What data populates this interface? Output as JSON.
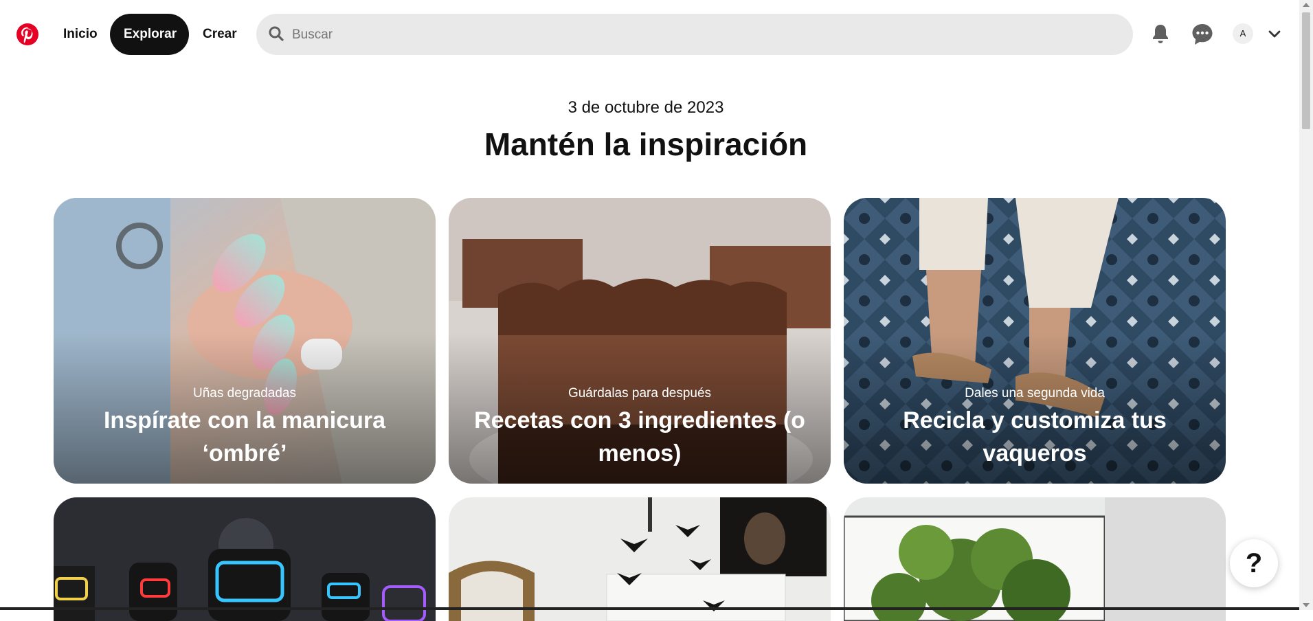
{
  "header": {
    "nav": {
      "home_label": "Inicio",
      "explore_label": "Explorar",
      "create_label": "Crear"
    },
    "search": {
      "placeholder": "Buscar",
      "value": ""
    },
    "avatar_initial": "A",
    "icons": [
      "pinterest-logo",
      "search-icon",
      "bell-icon",
      "chat-icon",
      "chevron-down-icon"
    ]
  },
  "main": {
    "date": "3 de octubre de 2023",
    "title": "Mantén la inspiración",
    "cards": [
      {
        "subtitle": "Uñas degradadas",
        "title": "Inspírate con la manicura ‘ombré’"
      },
      {
        "subtitle": "Guárdalas para después",
        "title": "Recetas con 3 ingredientes (o menos)"
      },
      {
        "subtitle": "Dales una segunda vida",
        "title": "Recicla y customiza tus vaqueros"
      }
    ]
  },
  "help_label": "?",
  "colors": {
    "brand": "#e60023",
    "active_nav": "#111111",
    "search_bg": "#e9e9e9"
  }
}
